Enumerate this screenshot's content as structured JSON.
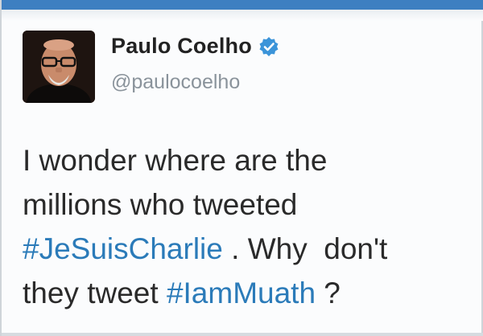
{
  "colors": {
    "accent_bar": "#3d7fc1",
    "hashtag": "#2b7bb9",
    "verified": "#3b94d9",
    "text": "#2a2a2a",
    "handle": "#8a939b"
  },
  "author": {
    "display_name": "Paulo Coelho",
    "handle": "@paulocoelho",
    "verified_icon": "verified-badge-icon",
    "avatar_icon": "profile-photo"
  },
  "tweet": {
    "line1": "I wonder where are the",
    "line2": "millions who tweeted",
    "hashtag1": "#JeSuisCharlie",
    "line3_rest": " . Why  don't",
    "line4_start": "they tweet ",
    "hashtag2": "#IamMuath",
    "line4_end": " ?"
  }
}
